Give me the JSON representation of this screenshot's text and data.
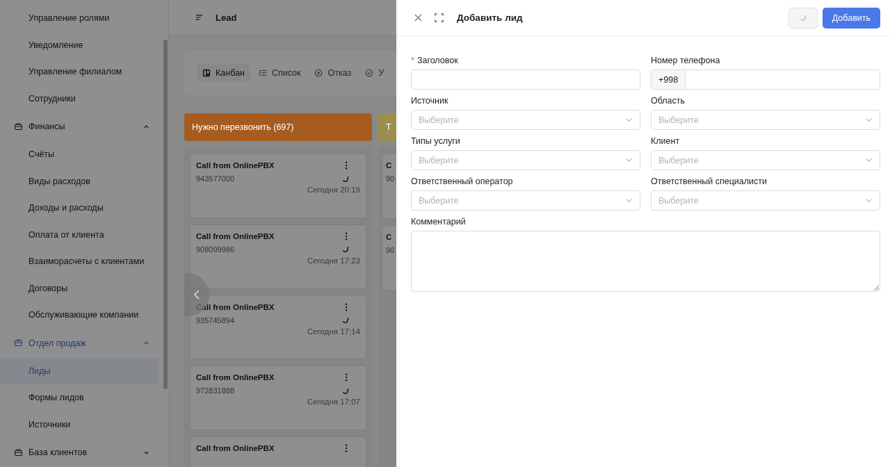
{
  "sidebar": {
    "items": [
      {
        "kind": "item",
        "label": "Управление ролями",
        "selected": false
      },
      {
        "kind": "item",
        "label": "Уведомление",
        "selected": false
      },
      {
        "kind": "item",
        "label": "Управление филиалом",
        "selected": false
      },
      {
        "kind": "item",
        "label": "Сотрудники",
        "selected": false
      },
      {
        "kind": "group",
        "label": "Финансы",
        "selected": false,
        "expanded": true,
        "children": [
          {
            "label": "Счёты",
            "selected": false
          },
          {
            "label": "Виды расходов",
            "selected": false
          },
          {
            "label": "Доходы и расходы",
            "selected": false
          },
          {
            "label": "Оплата от клиента",
            "selected": false
          },
          {
            "label": "Взаиморасчеты с клиентами",
            "selected": false
          },
          {
            "label": "Договоры",
            "selected": false
          },
          {
            "label": "Обслуживающие компании",
            "selected": false
          }
        ]
      },
      {
        "kind": "group",
        "label": "Отдел продаж",
        "selected": true,
        "expanded": true,
        "children": [
          {
            "label": "Лиды",
            "selected": true
          },
          {
            "label": "Формы лидов",
            "selected": false
          },
          {
            "label": "Источники",
            "selected": false
          }
        ]
      },
      {
        "kind": "group",
        "label": "База клиентов",
        "selected": false,
        "expanded": false
      }
    ]
  },
  "header": {
    "title": "Lead"
  },
  "view_tabs": [
    {
      "label": "Канбан",
      "selected": true
    },
    {
      "label": "Список",
      "selected": false
    },
    {
      "label": "Отказ",
      "selected": false
    },
    {
      "label": "У",
      "selected": false
    }
  ],
  "kanban": [
    {
      "title": "Нужно перезвонить (697)",
      "color": "#a65c1f",
      "cards": [
        {
          "title": "Call from OnlinePBX",
          "phone": "943577000",
          "time": "Сегодня 20:19"
        },
        {
          "title": "Call from OnlinePBX",
          "phone": "908099986",
          "time": "Сегодня 17:23"
        },
        {
          "title": "Call from OnlinePBX",
          "phone": "935745894",
          "time": "Сегодня 17:14"
        },
        {
          "title": "Call from OnlinePBX",
          "phone": "972831888",
          "time": "Сегодня 17:07"
        },
        {
          "title": "Call from OnlinePBX"
        }
      ]
    },
    {
      "title": "Т",
      "color": "#9c8f4e",
      "cards": [
        {
          "title": "C",
          "phone": "90"
        },
        {
          "title": "C",
          "phone": "90"
        }
      ]
    }
  ],
  "drawer": {
    "title": "Добавить лид",
    "submit": "Добавить",
    "fields": [
      {
        "kind": "input",
        "label": "Заголовок",
        "required_mark": "*"
      },
      {
        "kind": "phone",
        "label": "Номер телефона",
        "prefix": "+998"
      },
      {
        "kind": "select",
        "label": "Источник",
        "placeholder": "Выберите"
      },
      {
        "kind": "select",
        "label": "Область",
        "placeholder": "Выберите"
      },
      {
        "kind": "select",
        "label": "Типы услуги",
        "placeholder": "Выберите"
      },
      {
        "kind": "select",
        "label": "Клиент",
        "placeholder": "Выберите"
      },
      {
        "kind": "select",
        "label": "Ответственный оператор",
        "placeholder": "Выберите"
      },
      {
        "kind": "select",
        "label": "Ответственный специалисти",
        "placeholder": "Выберите"
      },
      {
        "kind": "textarea",
        "label": "Комментарий"
      }
    ]
  }
}
